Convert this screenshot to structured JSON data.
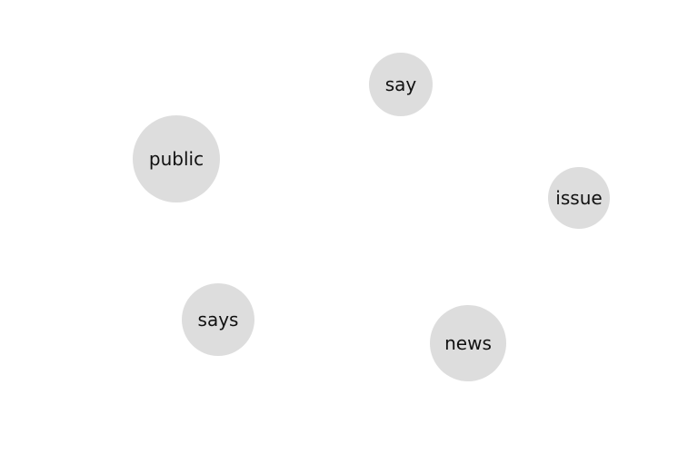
{
  "diagram": {
    "bubble_color": "#dddddd",
    "text_color": "#111111",
    "nodes": [
      {
        "label": "say"
      },
      {
        "label": "public"
      },
      {
        "label": "issue"
      },
      {
        "label": "says"
      },
      {
        "label": "news"
      }
    ]
  }
}
